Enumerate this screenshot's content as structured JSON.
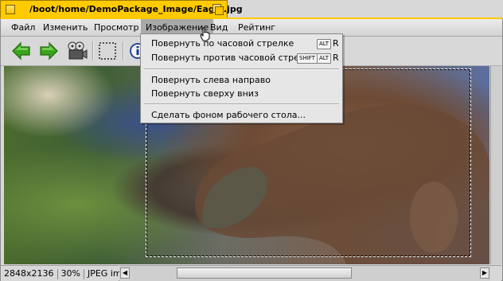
{
  "window": {
    "title": "/boot/home/DemoPackage_Image/Eagle.jpg"
  },
  "menubar": {
    "items": [
      {
        "label": "Файл"
      },
      {
        "label": "Изменить"
      },
      {
        "label": "Просмотр"
      },
      {
        "label": "Изображение"
      },
      {
        "label": "Вид"
      },
      {
        "label": "Рейтинг"
      }
    ]
  },
  "toolbar": {
    "icons": [
      "back-arrow-icon",
      "forward-arrow-icon",
      "slideshow-projector-icon",
      "selection-icon",
      "info-icon"
    ]
  },
  "dropdown": {
    "items": [
      {
        "label": "Повернуть по часовой стрелке",
        "mod1": "ALT",
        "key": "R"
      },
      {
        "label": "Повернуть против часовой стрелки",
        "mod0": "SHIFT",
        "mod1": "ALT",
        "key": "R"
      },
      {
        "label": "Повернуть слева направо"
      },
      {
        "label": "Повернуть сверху вниз"
      },
      {
        "label": "Сделать фоном рабочего стола..."
      }
    ]
  },
  "status": {
    "dimensions": "2848x2136",
    "zoom": "30%",
    "type": "JPEG image"
  },
  "colors": {
    "title_tab": "#ffcb00",
    "menu_highlight": "#a9a9a9",
    "arrow_green": "#3aa41c"
  }
}
